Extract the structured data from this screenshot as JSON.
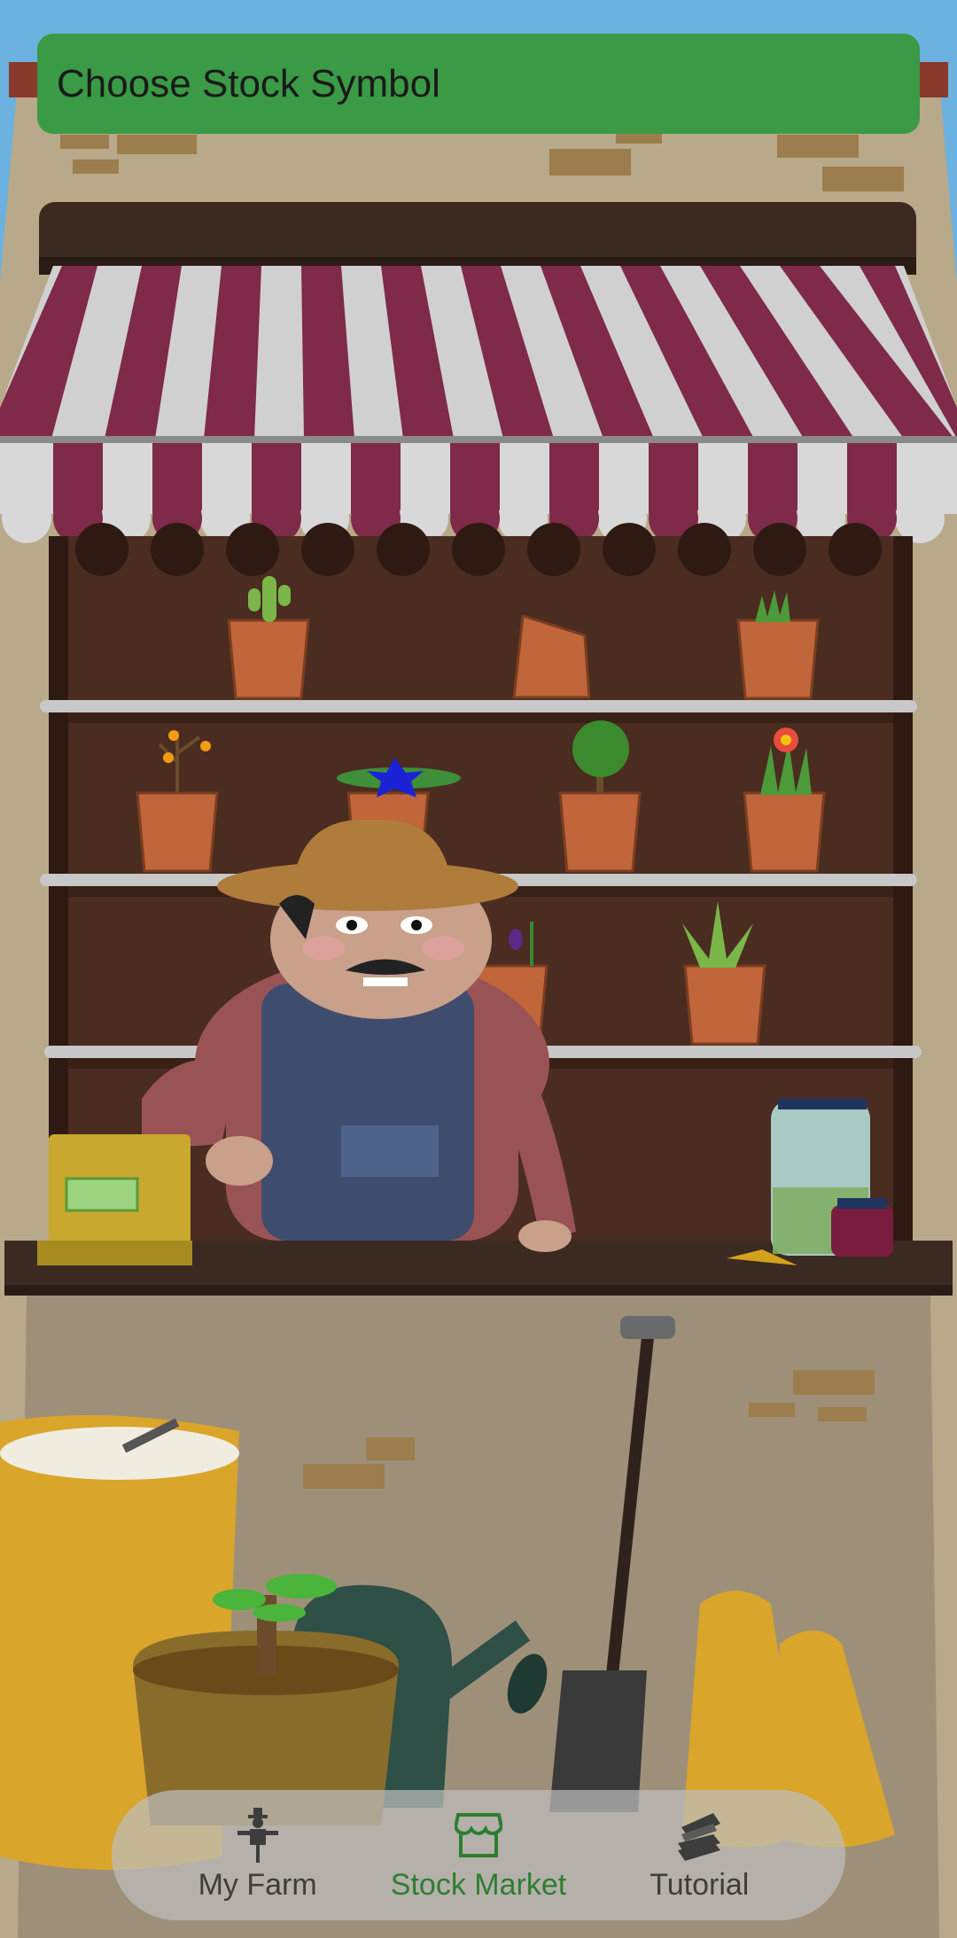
{
  "header": {
    "title": "Choose Stock Symbol"
  },
  "nav": {
    "items": [
      {
        "label": "My Farm",
        "icon": "scarecrow-icon",
        "active": false
      },
      {
        "label": "Stock Market",
        "icon": "storefront-icon",
        "active": true
      },
      {
        "label": "Tutorial",
        "icon": "books-icon",
        "active": false
      }
    ]
  },
  "colors": {
    "accent": "#3a9a45",
    "active_nav": "#2e7d32",
    "inactive_nav": "#3d3d3d"
  }
}
